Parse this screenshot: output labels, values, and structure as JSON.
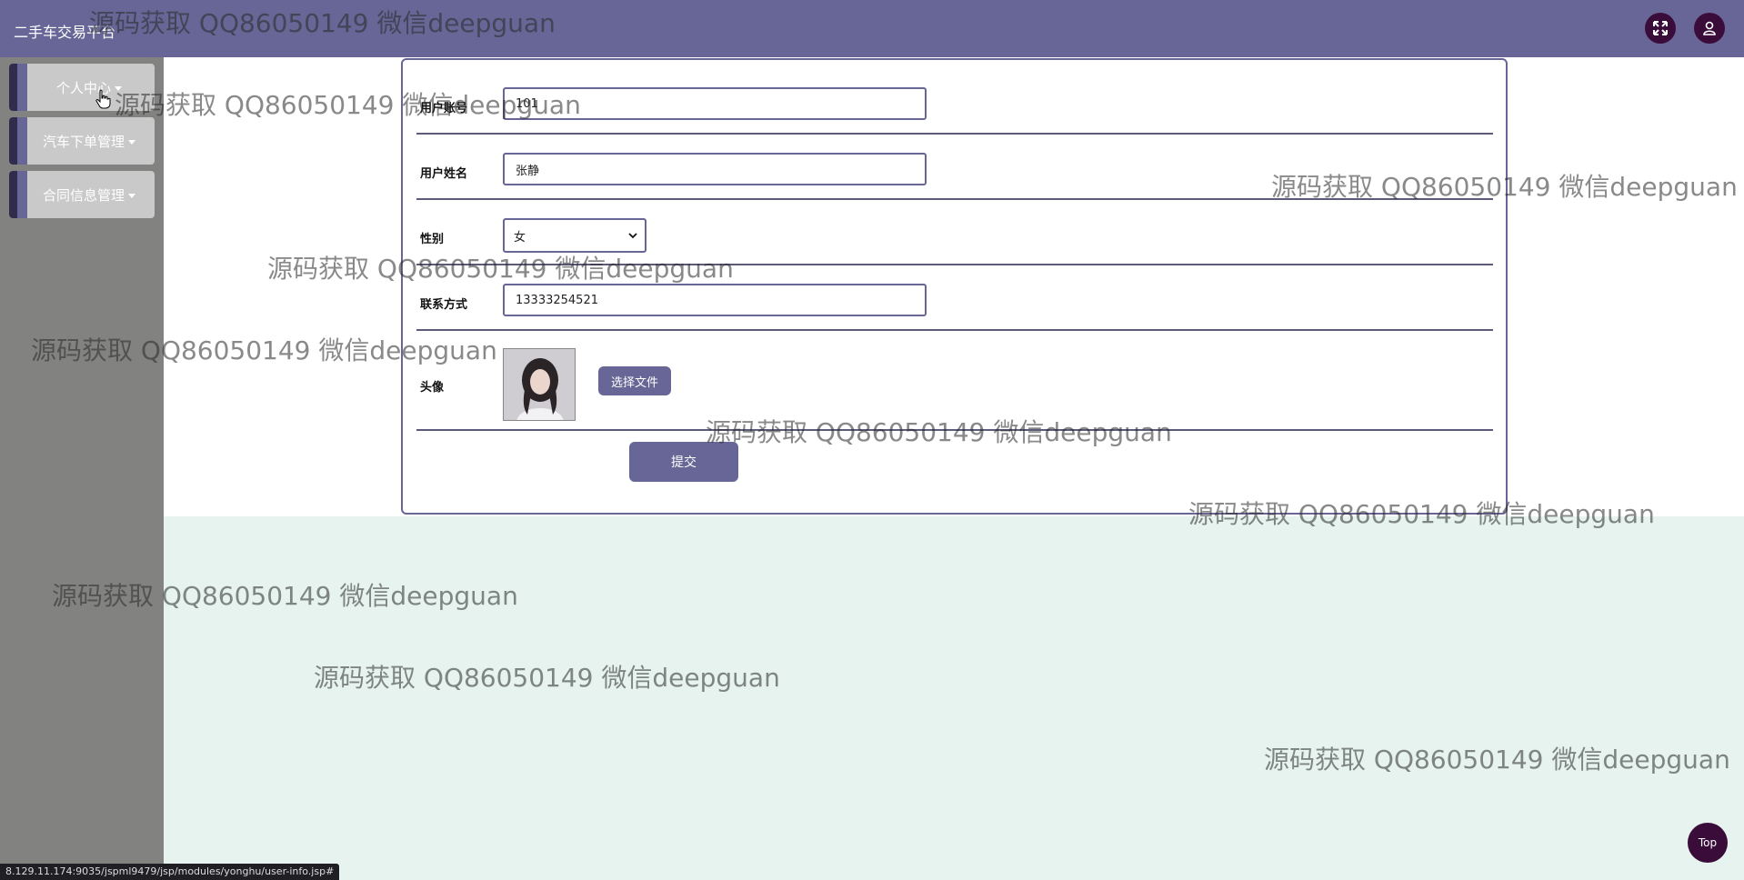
{
  "header": {
    "site_title": "二手车交易平台",
    "icons": [
      "fullscreen-icon",
      "user-icon"
    ]
  },
  "sidebar": {
    "items": [
      {
        "label": "个人中心"
      },
      {
        "label": "汽车下单管理"
      },
      {
        "label": "合同信息管理"
      }
    ]
  },
  "form": {
    "fields": [
      {
        "label": "用户账号",
        "value": "101"
      },
      {
        "label": "用户姓名",
        "value": "张静"
      },
      {
        "label": "性别",
        "value": "女"
      },
      {
        "label": "联系方式",
        "value": "13333254521"
      },
      {
        "label": "头像"
      }
    ],
    "file_button": "选择文件",
    "submit": "提交"
  },
  "top_button": "Top",
  "status_url": "8.129.11.174:9035/jspml9479/jsp/modules/yonghu/user-info.jsp#",
  "watermark": "源码获取 QQ86050149 微信deepguan",
  "colors": {
    "header": "#676696",
    "sidebar": "#828381",
    "background": "#e6f3ee",
    "accent_dark": "#3a0c3a"
  }
}
